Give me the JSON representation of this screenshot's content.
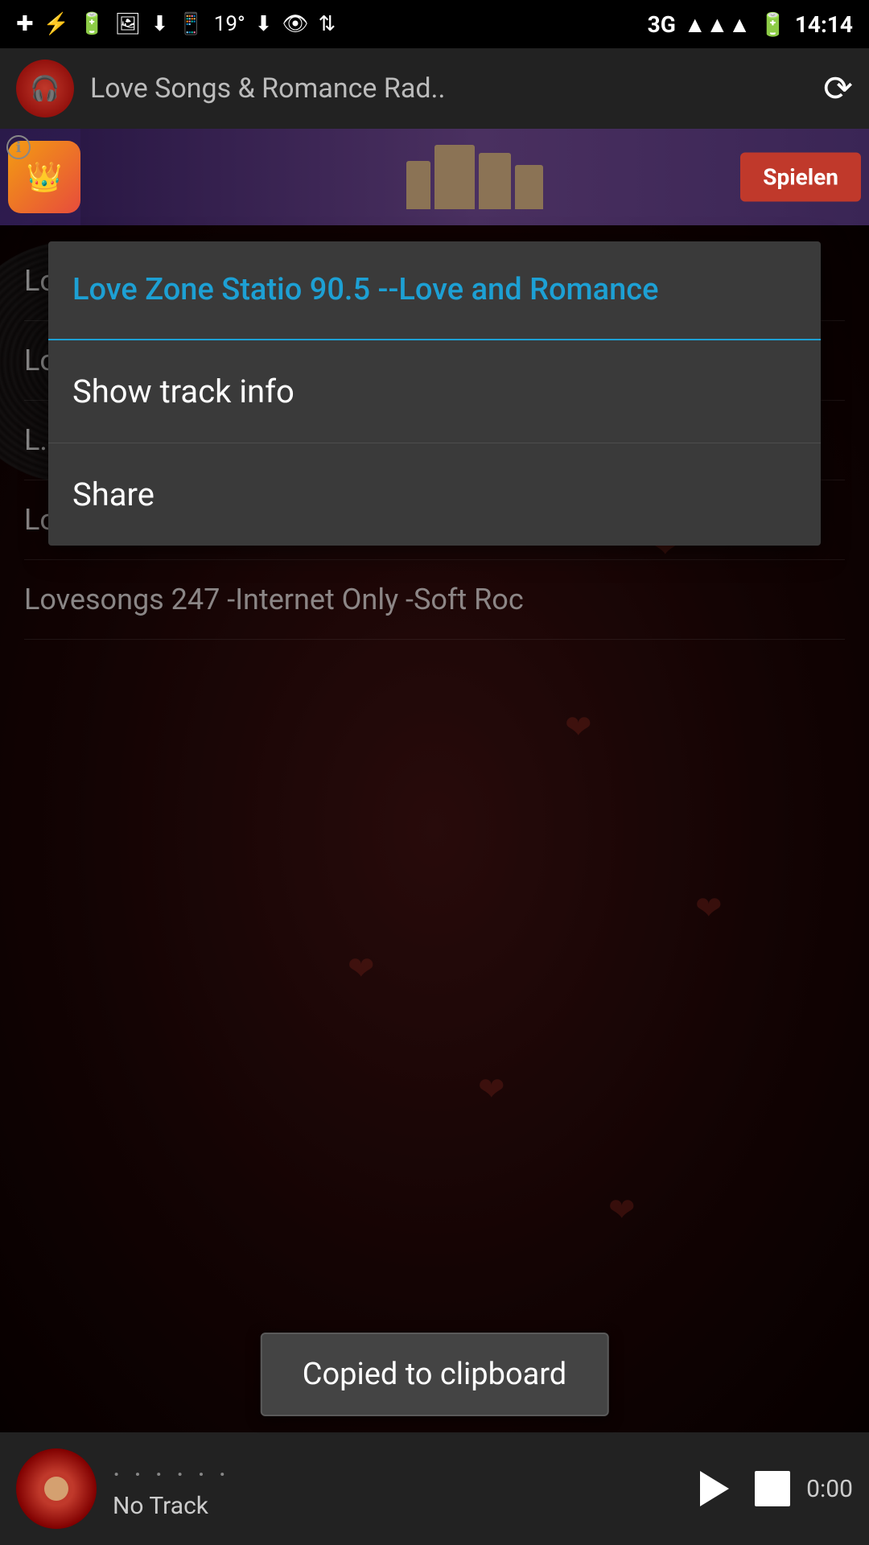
{
  "statusBar": {
    "time": "14:14",
    "network": "3G",
    "battery": "100%",
    "temperature": "19°"
  },
  "toolbar": {
    "title": "Love Songs & Romance Rad..",
    "refreshLabel": "⟳"
  },
  "ad": {
    "playLabel": "Spielen"
  },
  "radioItems": [
    {
      "label": "Love Song radio --Love and Romance"
    },
    {
      "label": "Love Songs Radio-Internet Only -Oldie"
    },
    {
      "label": "L..."
    },
    {
      "label": "Lovers Radio-Montreal QC Canada -Po."
    },
    {
      "label": "Lovesongs 247 -Internet Only -Soft Roc"
    }
  ],
  "contextMenu": {
    "title": "Love Zone Statio 90.5 --Love and Romance",
    "items": [
      {
        "label": "Show track info"
      },
      {
        "label": "Share"
      }
    ]
  },
  "player": {
    "dots": "· · · · · ·",
    "track": "No Track",
    "time": "0:00"
  },
  "toast": {
    "message": "Copied to clipboard"
  }
}
